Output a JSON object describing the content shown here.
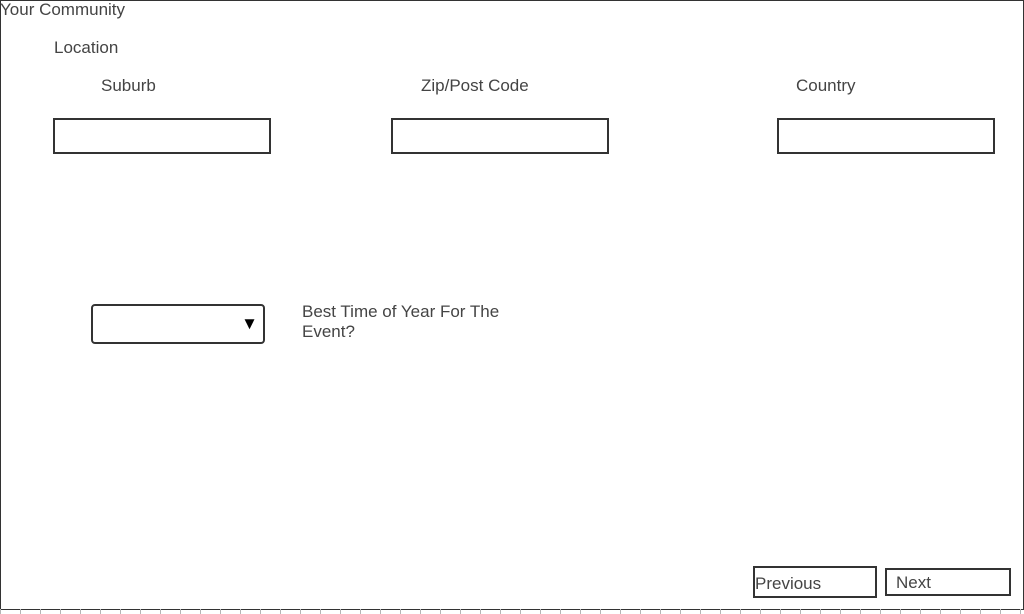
{
  "page": {
    "title": "Your Community"
  },
  "location": {
    "heading": "Location",
    "suburb": {
      "label": "Suburb",
      "value": "",
      "placeholder": ""
    },
    "postcode": {
      "label": "Zip/Post Code",
      "value": "",
      "placeholder": ""
    },
    "country": {
      "label": "Country",
      "value": "",
      "placeholder": ""
    }
  },
  "event_time": {
    "selected": "",
    "caret_icon": "triangle-down-icon",
    "question": "Best Time of Year For The Event?"
  },
  "nav": {
    "previous_label": "Previous",
    "next_label": "Next"
  }
}
